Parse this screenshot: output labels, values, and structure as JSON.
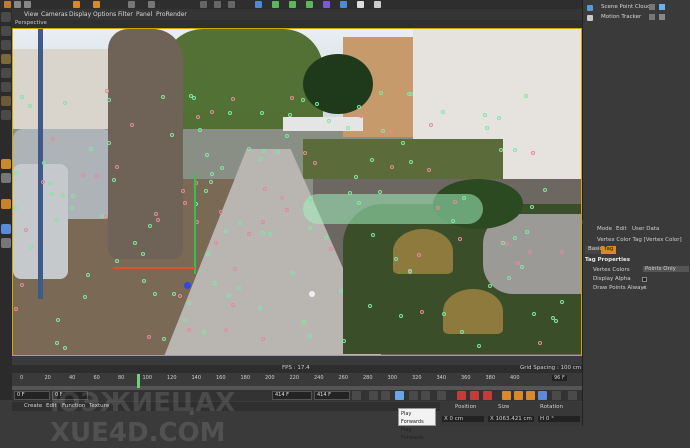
{
  "viewport_menu": [
    "View",
    "Cameras",
    "Display",
    "Options",
    "Filter",
    "Panel",
    "ProRender"
  ],
  "viewport_name": "Perspective",
  "status": {
    "fps": "FPS : 17.4",
    "grid_spacing": "Grid Spacing : 100 cm"
  },
  "timeline": {
    "ticks": [
      "0",
      "20",
      "40",
      "60",
      "80",
      "100",
      "120",
      "140",
      "160",
      "180",
      "200",
      "220",
      "240",
      "260",
      "280",
      "300",
      "320",
      "340",
      "360",
      "380",
      "400"
    ],
    "current_frame": "96 F"
  },
  "transport": {
    "start": "0 F",
    "field2": "0 F",
    "end_a": "414 F",
    "end_b": "414 F"
  },
  "tooltip": {
    "line1": "Play Forwards",
    "line2": "Play Forwards"
  },
  "material_menu": [
    "Create",
    "Edit",
    "Function",
    "Texture"
  ],
  "coords": {
    "position": "Position",
    "size": "Size",
    "rotation": "Rotation",
    "x_pos": "X  0 cm",
    "x_size": "X  1063.421 cm",
    "h_rot": "H  0 °"
  },
  "objects": [
    {
      "label": "Scene Point Cloud",
      "color": "#5a9ad8"
    },
    {
      "label": "Motion Tracker",
      "color": "#c8c8c8"
    }
  ],
  "attributes": {
    "menu": [
      "Mode",
      "Edit",
      "User Data"
    ],
    "title": "Vertex Color Tag [Vertex Color]",
    "tabs": [
      "Basic",
      "Tag"
    ],
    "section": "Tag Properties",
    "rows": [
      {
        "label": "Vertex Colors",
        "value": "Points Only"
      },
      {
        "label": "Display Alpha",
        "value": ""
      },
      {
        "label": "Draw Points Always",
        "value": "✓"
      }
    ]
  },
  "watermark": "ЮЭЖИЕЦАХ\nXUE4D.COM"
}
